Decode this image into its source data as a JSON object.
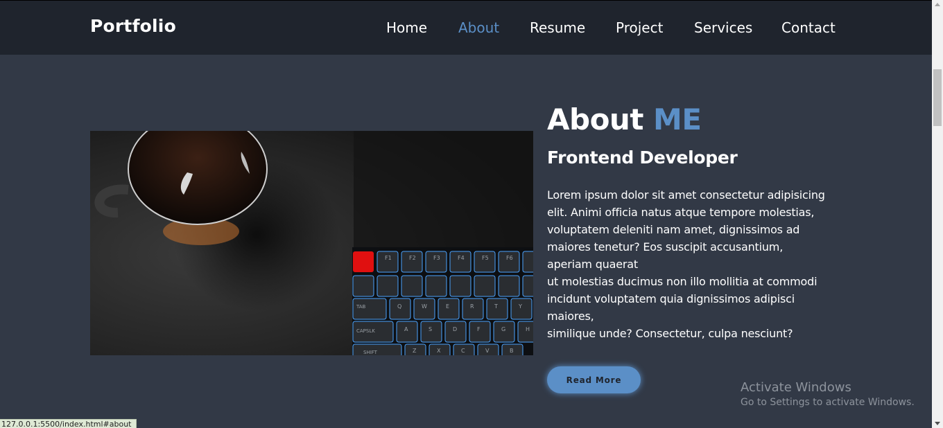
{
  "header": {
    "logo": "Portfolio",
    "nav": [
      {
        "label": "Home",
        "active": false
      },
      {
        "label": "About",
        "active": true
      },
      {
        "label": "Resume",
        "active": false
      },
      {
        "label": "Project",
        "active": false
      },
      {
        "label": "Services",
        "active": false
      },
      {
        "label": "Contact",
        "active": false
      }
    ]
  },
  "about": {
    "title_main": "About",
    "title_accent": "ME",
    "subtitle": "Frontend Developer",
    "paragraph_lines": [
      "Lorem ipsum dolor sit amet consectetur adipisicing",
      "elit. Animi officia natus atque tempore molestias,",
      "voluptatem deleniti nam amet, dignissimos ad",
      "maiores tenetur? Eos suscipit accusantium,",
      "aperiam quaerat",
      "ut molestias ducimus non illo mollitia at commodi",
      "incidunt voluptatem quia dignissimos adipisci",
      "maiores,",
      "similique unde? Consectetur, culpa nesciunt?"
    ],
    "button_label": "Read More",
    "image_keys": {
      "row1": [
        "F1",
        "F2",
        "F3",
        "F4",
        "F5",
        "F6"
      ],
      "row3": [
        "TAB",
        "Q",
        "W",
        "E",
        "R",
        "T",
        "Y"
      ],
      "row4": [
        "CAPSLK",
        "A",
        "S",
        "D",
        "F",
        "G",
        "H"
      ],
      "row5": [
        "SHIFT",
        "Z",
        "X",
        "C",
        "V",
        "B"
      ]
    }
  },
  "watermark": {
    "line1": "Activate Windows",
    "line2": "Go to Settings to activate Windows."
  },
  "status_url": "127.0.0.1:5500/index.html#about",
  "colors": {
    "accent": "#5b8fc7",
    "header_bg": "#1f242d",
    "page_bg": "#323946"
  }
}
